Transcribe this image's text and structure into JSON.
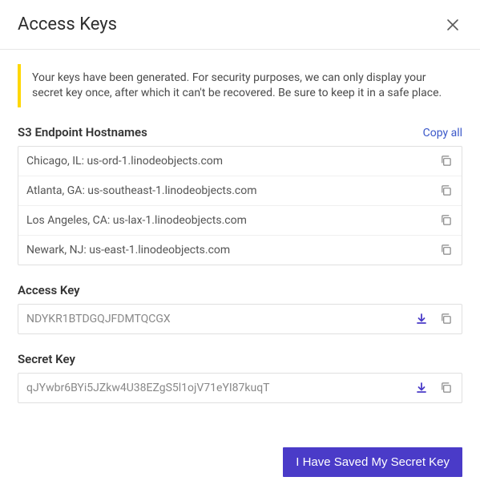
{
  "dialog": {
    "title": "Access Keys"
  },
  "notice": {
    "text": "Your keys have been generated. For security purposes, we can only display your secret key once, after which it can't be recovered. Be sure to keep it in a safe place."
  },
  "endpoints": {
    "title": "S3 Endpoint Hostnames",
    "copy_all_label": "Copy all",
    "items": [
      {
        "text": "Chicago, IL: us-ord-1.linodeobjects.com"
      },
      {
        "text": "Atlanta, GA: us-southeast-1.linodeobjects.com"
      },
      {
        "text": "Los Angeles, CA: us-lax-1.linodeobjects.com"
      },
      {
        "text": "Newark, NJ: us-east-1.linodeobjects.com"
      }
    ]
  },
  "access_key": {
    "title": "Access Key",
    "value": "NDYKR1BTDGQJFDMTQCGX"
  },
  "secret_key": {
    "title": "Secret Key",
    "value": "qJYwbr6BYi5JZkw4U38EZgS5l1ojV71eYI87kuqT"
  },
  "footer": {
    "confirm_label": "I Have Saved My Secret Key"
  }
}
